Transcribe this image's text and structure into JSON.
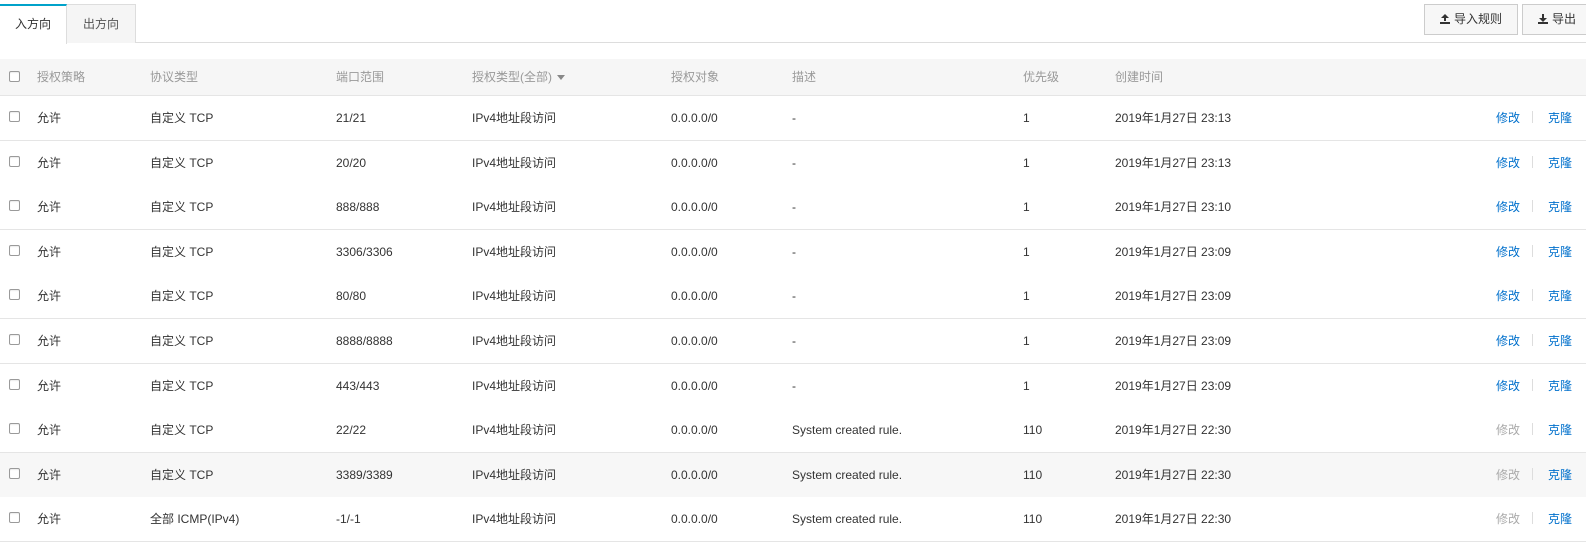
{
  "tabs": {
    "inbound": "入方向",
    "outbound": "出方向"
  },
  "toolbar": {
    "import_label": "导入规则",
    "export_label": "导出"
  },
  "columns": {
    "strategy": "授权策略",
    "protocol": "协议类型",
    "port": "端口范围",
    "auth_type": "授权类型(全部)",
    "auth_object": "授权对象",
    "description": "描述",
    "priority": "优先级",
    "created": "创建时间"
  },
  "actions": {
    "edit": "修改",
    "clone": "克隆"
  },
  "colors": {
    "accent": "#00a2ca",
    "link": "#0070cc",
    "disabled_link": "#aaaaaa"
  },
  "rows": [
    {
      "strategy": "允许",
      "protocol": "自定义 TCP",
      "port": "21/21",
      "auth_type": "IPv4地址段访问",
      "auth_object": "0.0.0.0/0",
      "description": "-",
      "priority": "1",
      "created": "2019年1月27日 23:13",
      "editable": true
    },
    {
      "strategy": "允许",
      "protocol": "自定义 TCP",
      "port": "20/20",
      "auth_type": "IPv4地址段访问",
      "auth_object": "0.0.0.0/0",
      "description": "-",
      "priority": "1",
      "created": "2019年1月27日 23:13",
      "editable": true
    },
    {
      "strategy": "允许",
      "protocol": "自定义 TCP",
      "port": "888/888",
      "auth_type": "IPv4地址段访问",
      "auth_object": "0.0.0.0/0",
      "description": "-",
      "priority": "1",
      "created": "2019年1月27日 23:10",
      "editable": true
    },
    {
      "strategy": "允许",
      "protocol": "自定义 TCP",
      "port": "3306/3306",
      "auth_type": "IPv4地址段访问",
      "auth_object": "0.0.0.0/0",
      "description": "-",
      "priority": "1",
      "created": "2019年1月27日 23:09",
      "editable": true
    },
    {
      "strategy": "允许",
      "protocol": "自定义 TCP",
      "port": "80/80",
      "auth_type": "IPv4地址段访问",
      "auth_object": "0.0.0.0/0",
      "description": "-",
      "priority": "1",
      "created": "2019年1月27日 23:09",
      "editable": true
    },
    {
      "strategy": "允许",
      "protocol": "自定义 TCP",
      "port": "8888/8888",
      "auth_type": "IPv4地址段访问",
      "auth_object": "0.0.0.0/0",
      "description": "-",
      "priority": "1",
      "created": "2019年1月27日 23:09",
      "editable": true
    },
    {
      "strategy": "允许",
      "protocol": "自定义 TCP",
      "port": "443/443",
      "auth_type": "IPv4地址段访问",
      "auth_object": "0.0.0.0/0",
      "description": "-",
      "priority": "1",
      "created": "2019年1月27日 23:09",
      "editable": true
    },
    {
      "strategy": "允许",
      "protocol": "自定义 TCP",
      "port": "22/22",
      "auth_type": "IPv4地址段访问",
      "auth_object": "0.0.0.0/0",
      "description": "System created rule.",
      "priority": "110",
      "created": "2019年1月27日 22:30",
      "editable": false
    },
    {
      "strategy": "允许",
      "protocol": "自定义 TCP",
      "port": "3389/3389",
      "auth_type": "IPv4地址段访问",
      "auth_object": "0.0.0.0/0",
      "description": "System created rule.",
      "priority": "110",
      "created": "2019年1月27日 22:30",
      "editable": false
    },
    {
      "strategy": "允许",
      "protocol": "全部 ICMP(IPv4)",
      "port": "-1/-1",
      "auth_type": "IPv4地址段访问",
      "auth_object": "0.0.0.0/0",
      "description": "System created rule.",
      "priority": "110",
      "created": "2019年1月27日 22:30",
      "editable": false
    }
  ]
}
